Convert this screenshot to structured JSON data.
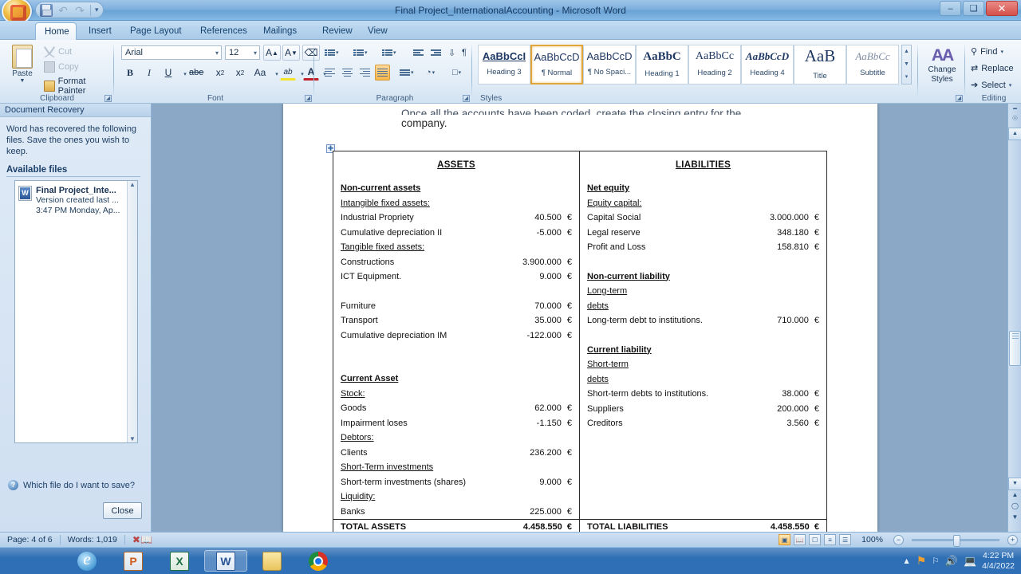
{
  "window": {
    "title": "Final Project_InternationalAccounting - Microsoft Word",
    "minimize": "–",
    "restore": "❐",
    "close": "✕"
  },
  "quick_access": {
    "save": "save-icon",
    "undo": "↶",
    "redo": "↷",
    "more": "▾"
  },
  "tabs": [
    {
      "label": "Home",
      "active": true
    },
    {
      "label": "Insert",
      "active": false
    },
    {
      "label": "Page Layout",
      "active": false
    },
    {
      "label": "References",
      "active": false
    },
    {
      "label": "Mailings",
      "active": false
    },
    {
      "label": "Review",
      "active": false
    },
    {
      "label": "View",
      "active": false
    }
  ],
  "ribbon": {
    "clipboard": {
      "group_label": "Clipboard",
      "paste": "Paste",
      "cut": "Cut",
      "copy": "Copy",
      "format_painter": "Format Painter"
    },
    "font": {
      "group_label": "Font",
      "font_name": "Arial",
      "font_size": "12",
      "grow": "A",
      "shrink": "A",
      "clear_formatting": "clear-formatting-icon",
      "bold": "B",
      "italic": "I",
      "underline": "U",
      "strikethrough": "abe",
      "subscript": "x",
      "superscript": "x",
      "change_case": "Aa",
      "highlight": "ab",
      "font_color": "A"
    },
    "paragraph": {
      "group_label": "Paragraph",
      "bullets": "bullets-icon",
      "numbering": "numbering-icon",
      "multilevel": "multilevel-list-icon",
      "decrease_indent": "decrease-indent-icon",
      "increase_indent": "increase-indent-icon",
      "sort": "sort-icon",
      "show_marks": "¶",
      "align_left": "align-left-icon",
      "align_center": "align-center-icon",
      "align_right": "align-right-icon",
      "justify": "justify-icon",
      "line_spacing": "line-spacing-icon",
      "shading": "shading-icon",
      "borders": "borders-icon"
    },
    "styles": {
      "group_label": "Styles",
      "items": [
        {
          "preview": "AaBbCcI",
          "name": "Heading 3",
          "selected": false
        },
        {
          "preview": "AaBbCcD",
          "name": "¶ Normal",
          "selected": true
        },
        {
          "preview": "AaBbCcD",
          "name": "¶ No Spaci...",
          "selected": false
        },
        {
          "preview": "AaBbC",
          "name": "Heading 1",
          "selected": false
        },
        {
          "preview": "AaBbCc",
          "name": "Heading 2",
          "selected": false
        },
        {
          "preview": "AaBbCcD",
          "name": "Heading 4",
          "selected": false
        },
        {
          "preview": "AaB",
          "name": "Title",
          "selected": false
        },
        {
          "preview": "AaBbCc",
          "name": "Subtitle",
          "selected": false
        }
      ],
      "change_styles": "Change Styles"
    },
    "editing": {
      "group_label": "Editing",
      "find": "Find",
      "replace": "Replace",
      "select": "Select"
    }
  },
  "recovery_pane": {
    "header": "Document Recovery",
    "description": "Word has recovered the following files.  Save the ones you wish to keep.",
    "available_files_label": "Available files",
    "files": [
      {
        "name": "Final Project_Inte...",
        "line1": "Version created last ...",
        "line2": "3:47 PM Monday, Ap..."
      }
    ],
    "help_link": "Which file do I want to save?",
    "close_button": "Close"
  },
  "document": {
    "text_above_partial": "Once all the accounts have been coded, create the closing entry for the",
    "text_line2": "company.",
    "table": {
      "assets_header": "ASSETS",
      "liabilities_header": "LIABILITIES",
      "currency": "€",
      "assets": [
        {
          "label": "Non-current assets",
          "value": "",
          "style": "bold-underline"
        },
        {
          "label": "Intangible fixed assets:",
          "value": "",
          "style": "underline"
        },
        {
          "label": "Industrial Propriety",
          "value": "40.500",
          "style": "normal"
        },
        {
          "label": "Cumulative depreciation II",
          "value": "-5.000",
          "style": "normal"
        },
        {
          "label": "Tangible fixed assets:",
          "value": "",
          "style": "underline"
        },
        {
          "label": "Constructions",
          "value": "3.900.000",
          "style": "normal"
        },
        {
          "label": "ICT Equipment.",
          "value": "9.000",
          "style": "normal"
        },
        {
          "label": "",
          "value": "",
          "style": "spacer"
        },
        {
          "label": "Furniture",
          "value": "70.000",
          "style": "normal"
        },
        {
          "label": "Transport",
          "value": "35.000",
          "style": "normal"
        },
        {
          "label": "Cumulative depreciation IM",
          "value": "-122.000",
          "style": "normal"
        },
        {
          "label": "",
          "value": "",
          "style": "spacer"
        },
        {
          "label": "",
          "value": "",
          "style": "spacer"
        },
        {
          "label": "Current Asset",
          "value": "",
          "style": "bold-underline"
        },
        {
          "label": "Stock:",
          "value": "",
          "style": "underline"
        },
        {
          "label": "Goods",
          "value": "62.000",
          "style": "normal"
        },
        {
          "label": "Impairment loses",
          "value": "-1.150",
          "style": "normal"
        },
        {
          "label": "Debtors:",
          "value": "",
          "style": "underline"
        },
        {
          "label": "Clients",
          "value": "236.200",
          "style": "normal"
        },
        {
          "label": "Short-Term investments",
          "value": "",
          "style": "underline"
        },
        {
          "label": "Short-term investments (shares)",
          "value": "9.000",
          "style": "normal"
        },
        {
          "label": "Liquidity:",
          "value": "",
          "style": "underline"
        },
        {
          "label": "Banks",
          "value": "225.000",
          "style": "normal"
        }
      ],
      "liabilities": [
        {
          "label": "Net equity",
          "value": "",
          "style": "bold-underline"
        },
        {
          "label": "Equity capital:",
          "value": "",
          "style": "underline"
        },
        {
          "label": "Capital Social",
          "value": "3.000.000",
          "style": "normal"
        },
        {
          "label": "Legal reserve",
          "value": "348.180",
          "style": "normal"
        },
        {
          "label": "Profit and Loss",
          "value": "158.810",
          "style": "normal"
        },
        {
          "label": "",
          "value": "",
          "style": "spacer"
        },
        {
          "label": "Non-current liability",
          "value": "",
          "style": "bold-underline"
        },
        {
          "label": "Long-term",
          "value": "",
          "style": "underline"
        },
        {
          "label": "debts",
          "value": "",
          "style": "underline"
        },
        {
          "label": "Long-term debt to institutions.",
          "value": "710.000",
          "style": "normal"
        },
        {
          "label": "",
          "value": "",
          "style": "spacer"
        },
        {
          "label": "Current liability",
          "value": "",
          "style": "bold-underline"
        },
        {
          "label": "Short-term",
          "value": "",
          "style": "underline"
        },
        {
          "label": "debts",
          "value": "",
          "style": "underline"
        },
        {
          "label": "Short-term debts to institutions.",
          "value": "38.000",
          "style": "normal"
        },
        {
          "label": "Suppliers",
          "value": "200.000",
          "style": "normal"
        },
        {
          "label": "Creditors",
          "value": "3.560",
          "style": "normal"
        }
      ],
      "total_assets_label": "TOTAL ASSETS",
      "total_assets_value": "4.458.550",
      "total_liabilities_label": "TOTAL LIABILITIES",
      "total_liabilities_value": "4.458.550"
    }
  },
  "status_bar": {
    "page": "Page: 4 of 6",
    "words": "Words: 1,019",
    "proofing": "proofing-icon",
    "zoom": "100%",
    "zoom_out": "−",
    "zoom_in": "+",
    "views": [
      "print-layout-view",
      "full-screen-reading-view",
      "web-layout-view",
      "outline-view",
      "draft-view"
    ]
  },
  "taskbar": {
    "buttons": [
      {
        "name": "internet-explorer",
        "active": false
      },
      {
        "name": "powerpoint",
        "active": false
      },
      {
        "name": "excel",
        "active": false
      },
      {
        "name": "word",
        "active": true
      },
      {
        "name": "file-explorer",
        "active": false
      },
      {
        "name": "chrome",
        "active": false
      }
    ],
    "tray": {
      "show_hidden": "▲",
      "action_center": "action-center-icon",
      "flag": "flag-icon",
      "volume": "volume-icon",
      "network": "network-icon",
      "time": "4:22 PM",
      "date": "4/4/2022"
    }
  },
  "colors": {
    "titlebar": "#7fb0de",
    "ribbon": "#e4eef8",
    "accent": "#2a5596",
    "close_red": "#d4504a",
    "selection_orange": "#f7b64a"
  }
}
